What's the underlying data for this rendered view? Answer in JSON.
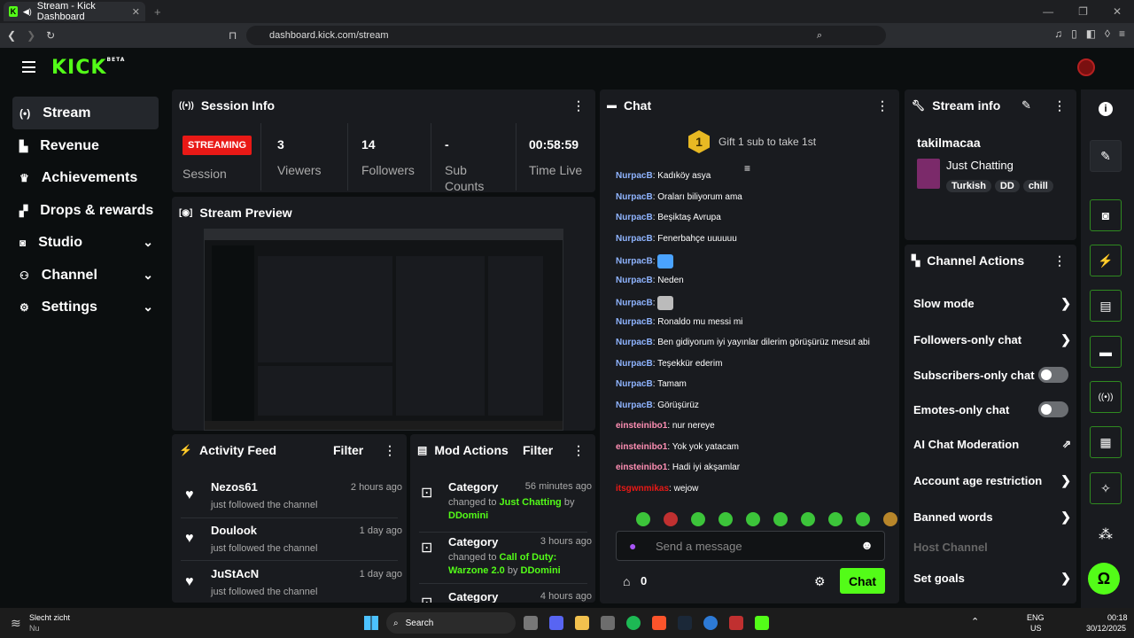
{
  "browser": {
    "tab_title": "Stream - Kick Dashboard",
    "url": "dashboard.kick.com/stream"
  },
  "brand": {
    "logo": "KICK",
    "beta": "BETA",
    "accent": "#53fc18",
    "live": "#e91916"
  },
  "sidebar": {
    "items": [
      {
        "label": "Stream"
      },
      {
        "label": "Revenue"
      },
      {
        "label": "Achievements"
      },
      {
        "label": "Drops & rewards"
      },
      {
        "label": "Studio"
      },
      {
        "label": "Channel"
      },
      {
        "label": "Settings"
      }
    ]
  },
  "session": {
    "title": "Session Info",
    "status": "STREAMING",
    "session_label": "Session",
    "stats": [
      {
        "value": "3",
        "label": "Viewers"
      },
      {
        "value": "14",
        "label": "Followers"
      },
      {
        "value": "-",
        "label": "Sub Counts"
      },
      {
        "value": "00:58:59",
        "label": "Time Live"
      }
    ]
  },
  "preview": {
    "title": "Stream Preview"
  },
  "activity": {
    "title": "Activity Feed",
    "filter": "Filter",
    "items": [
      {
        "name": "Nezos61",
        "sub": "just followed the channel",
        "time": "2 hours ago"
      },
      {
        "name": "Doulook",
        "sub": "just followed the channel",
        "time": "1 day ago"
      },
      {
        "name": "JuStAcN",
        "sub": "just followed the channel",
        "time": "1 day ago"
      }
    ]
  },
  "mod": {
    "title": "Mod Actions",
    "filter": "Filter",
    "items": [
      {
        "name": "Category",
        "time": "56 minutes ago",
        "pre": "changed to ",
        "value": "Just Chatting",
        "by": " by ",
        "user": "DDomini"
      },
      {
        "name": "Category",
        "time": "3 hours ago",
        "pre": "changed to ",
        "value": "Call of Duty: Warzone 2.0",
        "by": " by ",
        "user": "DDomini"
      },
      {
        "name": "Category",
        "time": "4 hours ago"
      }
    ]
  },
  "chat": {
    "title": "Chat",
    "gift": "Gift 1 sub to take 1st",
    "gift_rank": "1",
    "placeholder": "Send a message",
    "send": "Chat",
    "count": "0",
    "messages": [
      {
        "user": "NurpacB",
        "text": "Kadıköy asya"
      },
      {
        "user": "NurpacB",
        "text": "Oraları biliyorum ama"
      },
      {
        "user": "NurpacB",
        "text": "Beşiktaş Avrupa"
      },
      {
        "user": "NurpacB",
        "text": "Fenerbahçe uuuuuu"
      },
      {
        "user": "NurpacB",
        "text": ""
      },
      {
        "user": "NurpacB",
        "text": "Neden"
      },
      {
        "user": "NurpacB",
        "text": ""
      },
      {
        "user": "NurpacB",
        "text": "Ronaldo mu messi mi"
      },
      {
        "user": "NurpacB",
        "text": "Ben gidiyorum iyi yayınlar dilerim görüşürüz mesut abi"
      },
      {
        "user": "NurpacB",
        "text": "Teşekkür ederim"
      },
      {
        "user": "NurpacB",
        "text": "Tamam"
      },
      {
        "user": "NurpacB",
        "text": "Görüşürüz"
      },
      {
        "user": "einsteinibo1",
        "text": "nur nereye"
      },
      {
        "user": "einsteinibo1",
        "text": "Yok yok yatacam"
      },
      {
        "user": "einsteinibo1",
        "text": "Hadi iyi akşamlar"
      },
      {
        "user": "itsgwnmikas",
        "text": "wejow"
      }
    ]
  },
  "streaminfo": {
    "title": "Stream info",
    "channel": "takilmacaa",
    "category": "Just Chatting",
    "tags": [
      "Turkish",
      "DD",
      "chill"
    ]
  },
  "actions": {
    "title": "Channel Actions",
    "items": [
      {
        "label": "Slow mode",
        "kind": "arrow"
      },
      {
        "label": "Followers-only chat",
        "kind": "arrow"
      },
      {
        "label": "Subscribers-only chat",
        "kind": "toggle"
      },
      {
        "label": "Emotes-only chat",
        "kind": "toggle"
      },
      {
        "label": "AI Chat Moderation",
        "kind": "external"
      },
      {
        "label": "Account age restriction",
        "kind": "arrow"
      },
      {
        "label": "Banned words",
        "kind": "arrow"
      },
      {
        "label": "Host Channel",
        "kind": "disabled"
      },
      {
        "label": "Set goals",
        "kind": "arrow"
      }
    ]
  },
  "taskbar": {
    "weather": "Slecht zicht",
    "weather_sub": "Nu",
    "search": "Search",
    "lang": "ENG",
    "region": "US",
    "time": "00:18",
    "date": "30/12/2025"
  }
}
